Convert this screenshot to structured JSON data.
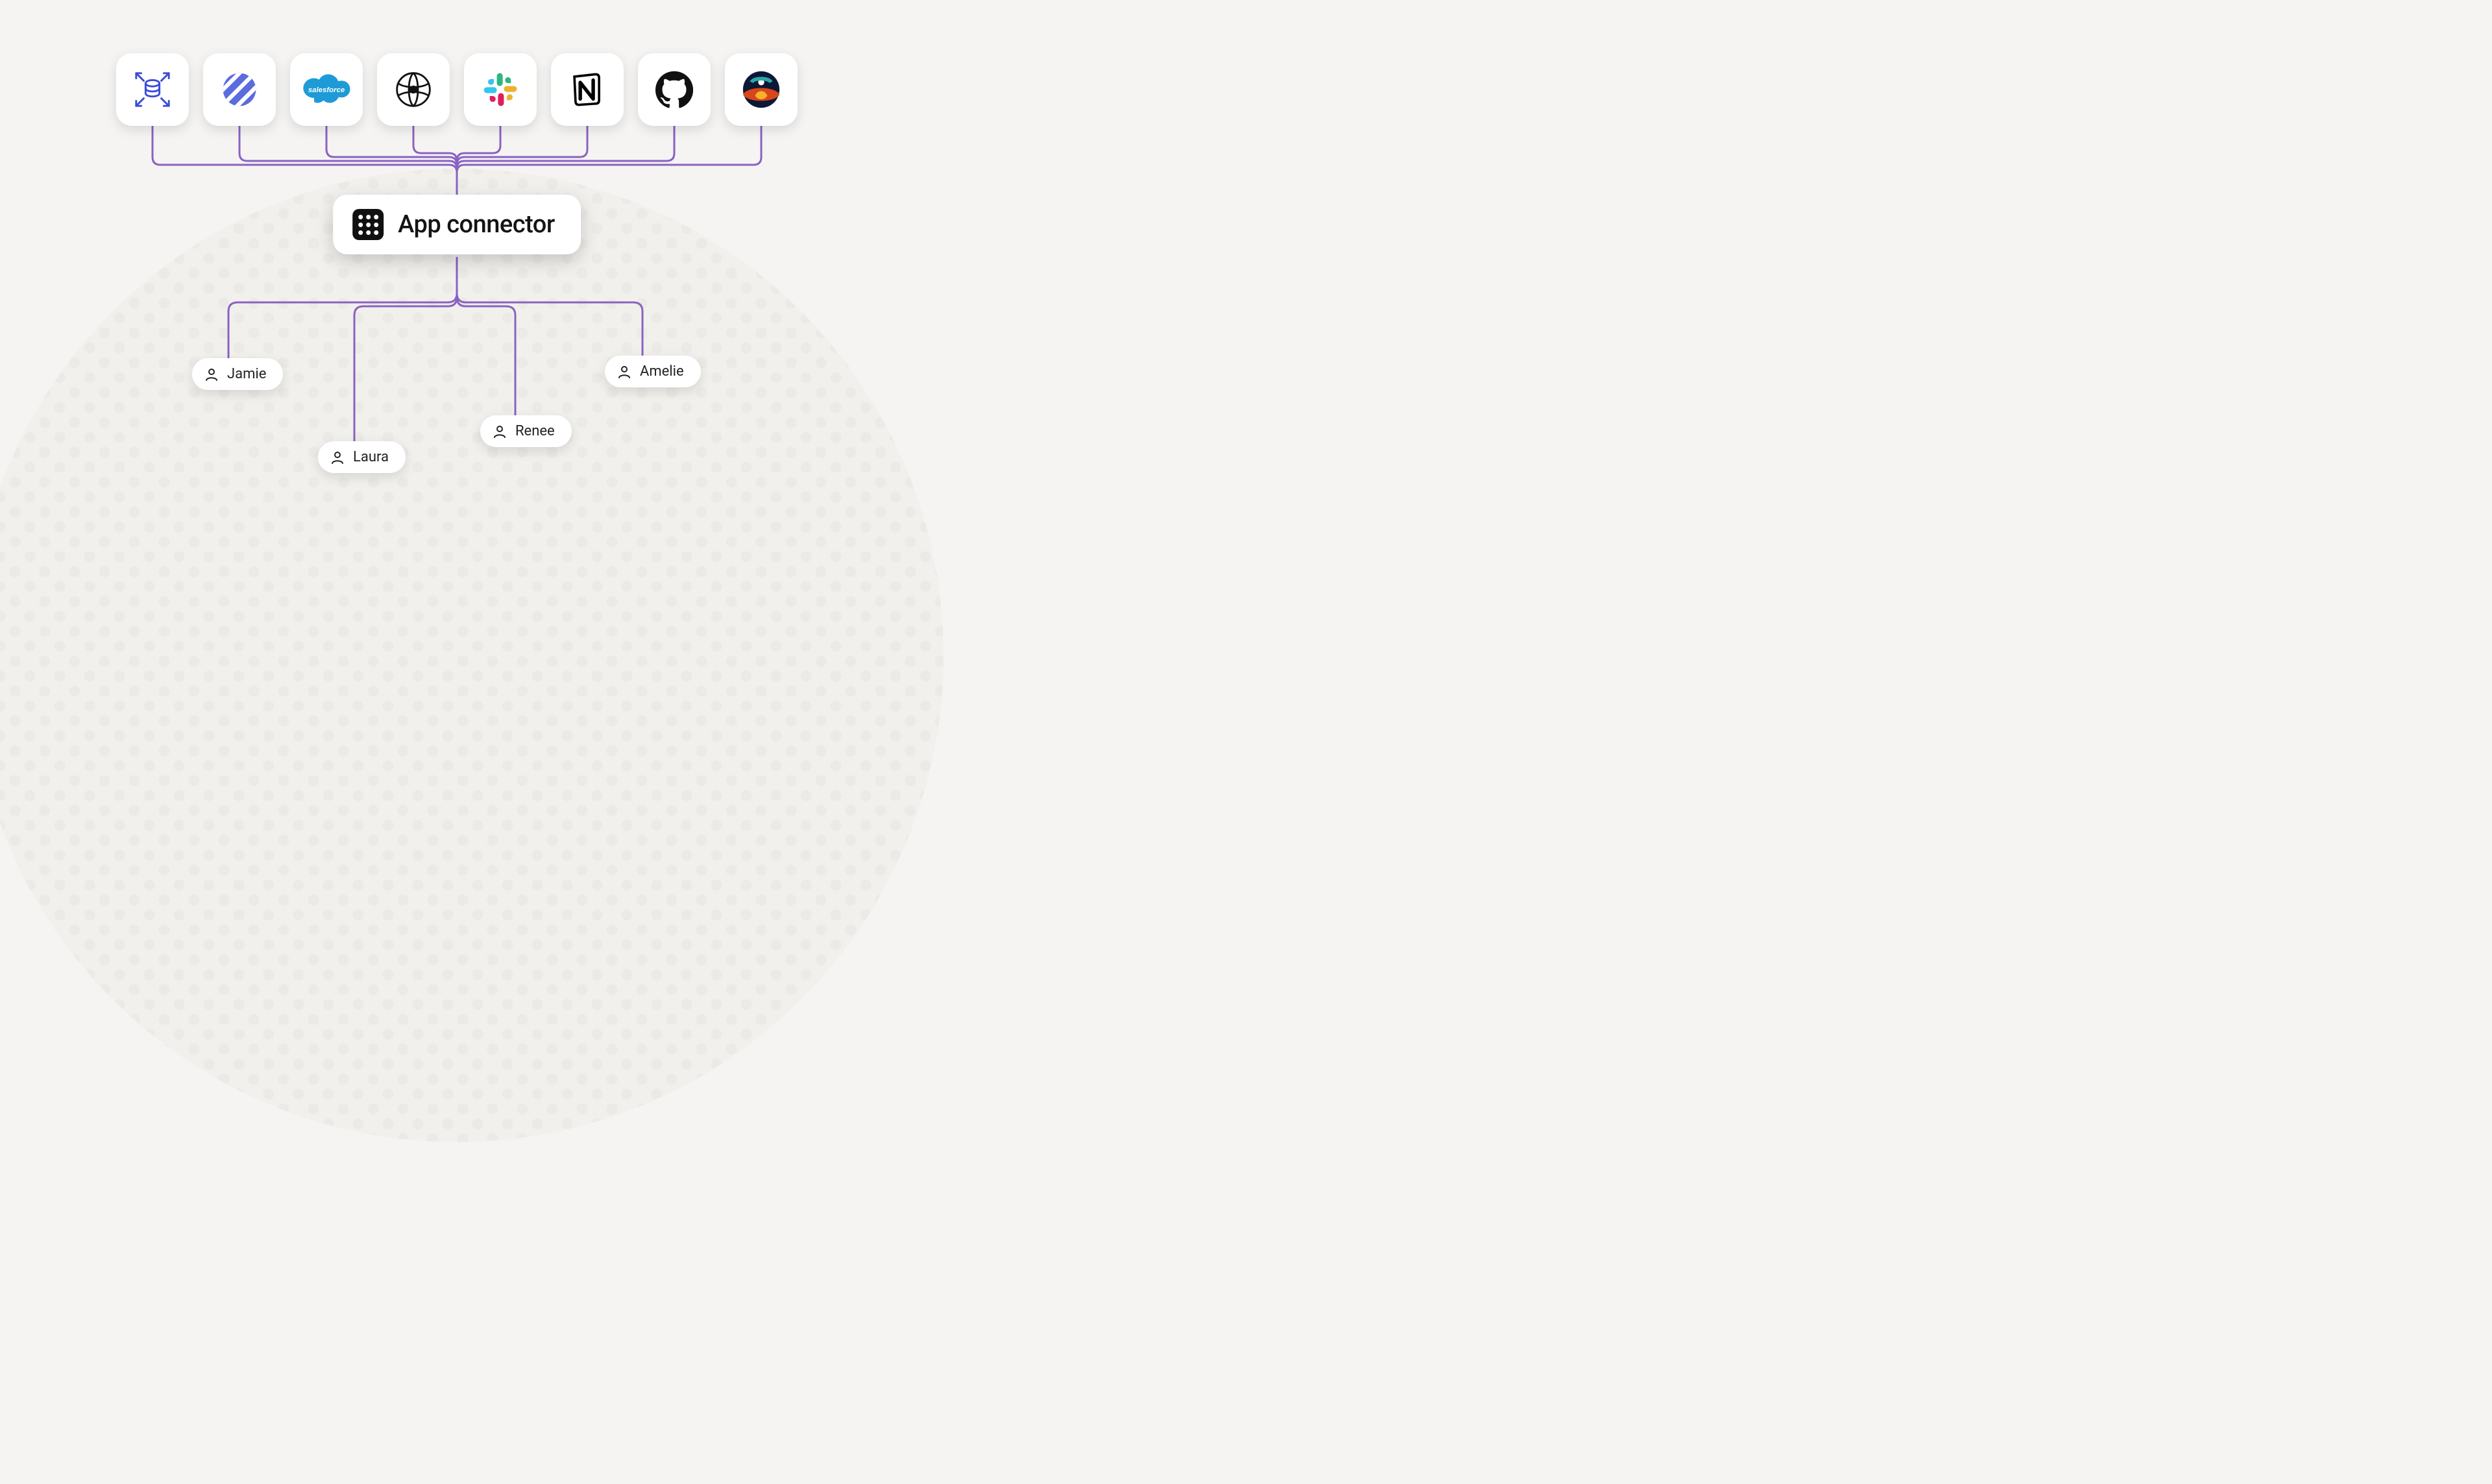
{
  "colors": {
    "connector": "#8a62c2",
    "background": "#f5f4f2"
  },
  "apps": [
    {
      "id": "aws-rds-icon"
    },
    {
      "id": "linear-icon"
    },
    {
      "id": "salesforce-icon"
    },
    {
      "id": "okta-icon"
    },
    {
      "id": "slack-icon"
    },
    {
      "id": "notion-icon"
    },
    {
      "id": "github-icon"
    },
    {
      "id": "atlassian-icon"
    }
  ],
  "hub": {
    "label": "App connector",
    "icon": "grid-9-icon"
  },
  "users": [
    {
      "name": "Jamie"
    },
    {
      "name": "Laura"
    },
    {
      "name": "Renee"
    },
    {
      "name": "Amelie"
    }
  ]
}
